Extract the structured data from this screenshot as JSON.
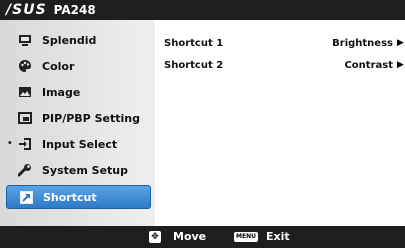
{
  "header": {
    "brand": "/SUS",
    "model": "PA248"
  },
  "sidebar": {
    "items": [
      {
        "label": "Splendid",
        "icon": "splendid-icon"
      },
      {
        "label": "Color",
        "icon": "palette-icon"
      },
      {
        "label": "Image",
        "icon": "image-icon"
      },
      {
        "label": "PIP/PBP Setting",
        "icon": "pip-icon"
      },
      {
        "label": "Input Select",
        "icon": "input-icon"
      },
      {
        "label": "System Setup",
        "icon": "wrench-icon"
      },
      {
        "label": "Shortcut",
        "icon": "shortcut-icon",
        "selected": true
      }
    ]
  },
  "content": {
    "rows": [
      {
        "label": "Shortcut 1",
        "value": "Brightness"
      },
      {
        "label": "Shortcut 2",
        "value": "Contrast"
      }
    ]
  },
  "footer": {
    "move_label": "Move",
    "menu_key": "MENU",
    "exit_label": "Exit"
  },
  "colors": {
    "selected_bg": "#3b8ad6",
    "bar_bg": "#1e1e1e",
    "sidebar_bg": "#e3e3e3"
  }
}
